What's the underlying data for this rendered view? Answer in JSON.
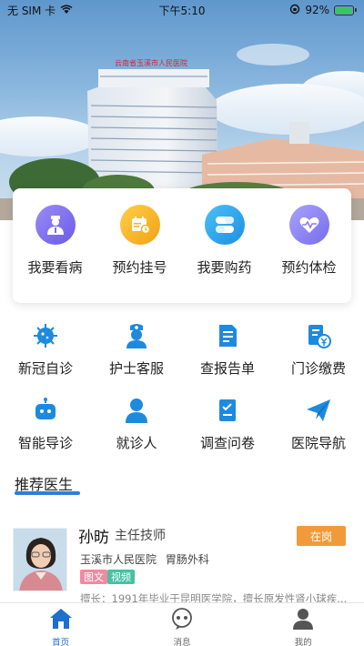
{
  "status_bar": {
    "carrier": "无 SIM 卡",
    "time": "下午5:10",
    "battery": "92%",
    "battery_level": 0.92
  },
  "hero": {
    "sign_text": "云南省玉溪市人民医院"
  },
  "quick_actions": [
    {
      "label": "我要看病",
      "icon": "doctor-icon",
      "color": "#7c6cf0"
    },
    {
      "label": "预约挂号",
      "icon": "registration-card-icon",
      "color": "#f5b324"
    },
    {
      "label": "我要购药",
      "icon": "pill-capsule-icon",
      "color": "#2fa3ea"
    },
    {
      "label": "预约体检",
      "icon": "heart-pulse-icon",
      "color": "#8a80f2"
    }
  ],
  "services": [
    {
      "label": "新冠自诊",
      "icon": "virus-icon"
    },
    {
      "label": "护士客服",
      "icon": "nurse-icon"
    },
    {
      "label": "查报告单",
      "icon": "report-icon"
    },
    {
      "label": "门诊缴费",
      "icon": "payment-bill-icon"
    },
    {
      "label": "智能导诊",
      "icon": "robot-icon"
    },
    {
      "label": "就诊人",
      "icon": "person-icon"
    },
    {
      "label": "调查问卷",
      "icon": "questionnaire-icon"
    },
    {
      "label": "医院导航",
      "icon": "paper-plane-icon"
    }
  ],
  "recommended": {
    "title": "推荐医生",
    "doctor": {
      "name": "孙昉",
      "title": "主任技师",
      "status": "在岗",
      "hospital": "玉溪市人民医院",
      "department": "胃肠外科",
      "tags": [
        "图文",
        "视频"
      ],
      "description": "擅长：1991年毕业于昆明医学院，擅长原发性肾小球疾..."
    }
  },
  "tabs": [
    {
      "label": "首页",
      "icon": "home-icon",
      "active": true
    },
    {
      "label": "消息",
      "icon": "message-icon",
      "active": false
    },
    {
      "label": "我的",
      "icon": "profile-icon",
      "active": false
    }
  ],
  "colors": {
    "accent": "#2a7fdb",
    "service_icon": "#1d8ae0",
    "status_badge": "#f29a3b",
    "tab_active": "#1d6fd0"
  }
}
